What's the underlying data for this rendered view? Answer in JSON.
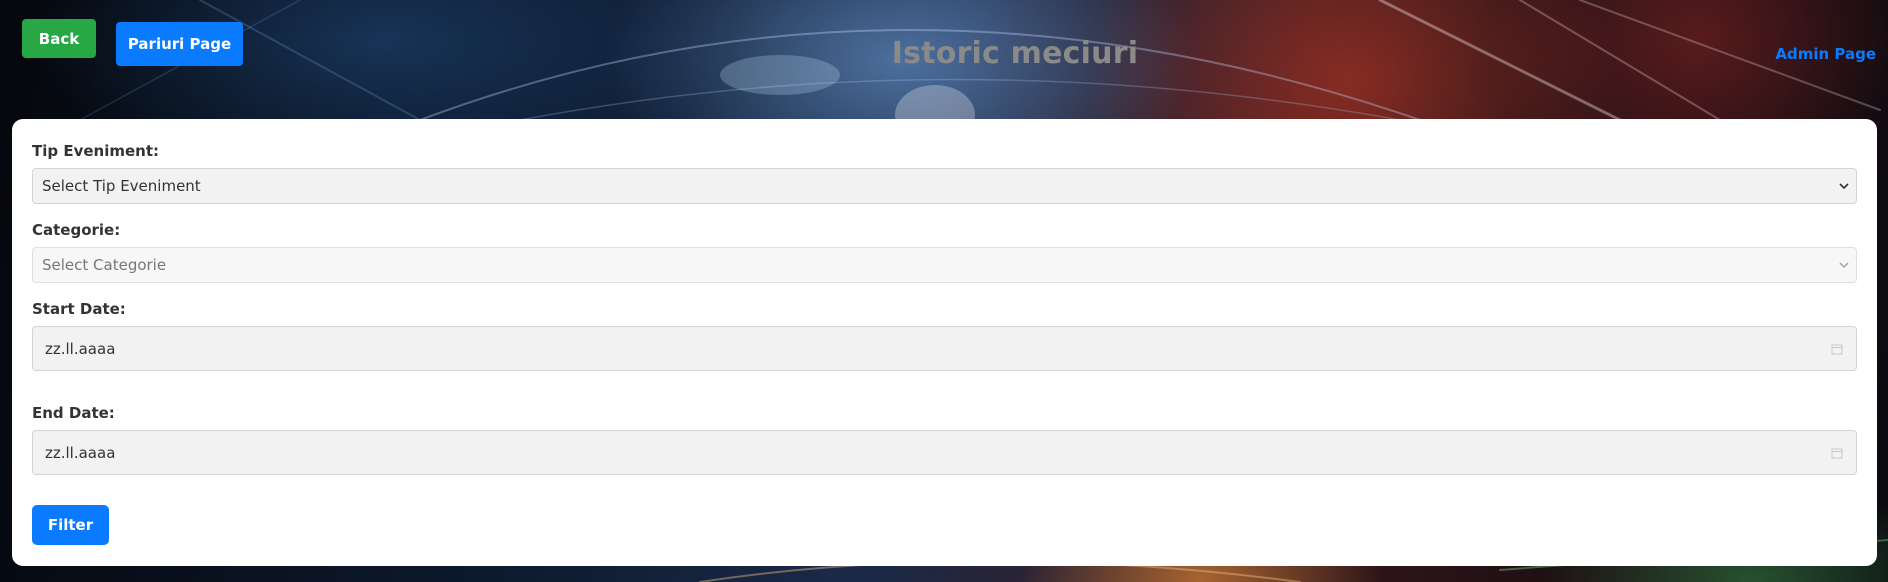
{
  "header": {
    "back_label": "Back",
    "pariuri_label": "Pariuri Page",
    "title": "Istoric meciuri",
    "admin_label": "Admin Page"
  },
  "form": {
    "tip_eveniment": {
      "label": "Tip Eveniment:",
      "value": "Select Tip Eveniment"
    },
    "categorie": {
      "label": "Categorie:",
      "value": "Select Categorie",
      "disabled": true
    },
    "start_date": {
      "label": "Start Date:",
      "placeholder": "zz.ll.aaaa"
    },
    "end_date": {
      "label": "End Date:",
      "placeholder": "zz.ll.aaaa"
    },
    "filter_label": "Filter"
  },
  "colors": {
    "back_button": "#28a745",
    "primary": "#0a7bff",
    "title": "#8a8a8a",
    "panel": "#ffffff",
    "input_bg": "#f2f2f2"
  },
  "icons": {
    "select": "chevron-down-icon",
    "date": "calendar-icon"
  }
}
